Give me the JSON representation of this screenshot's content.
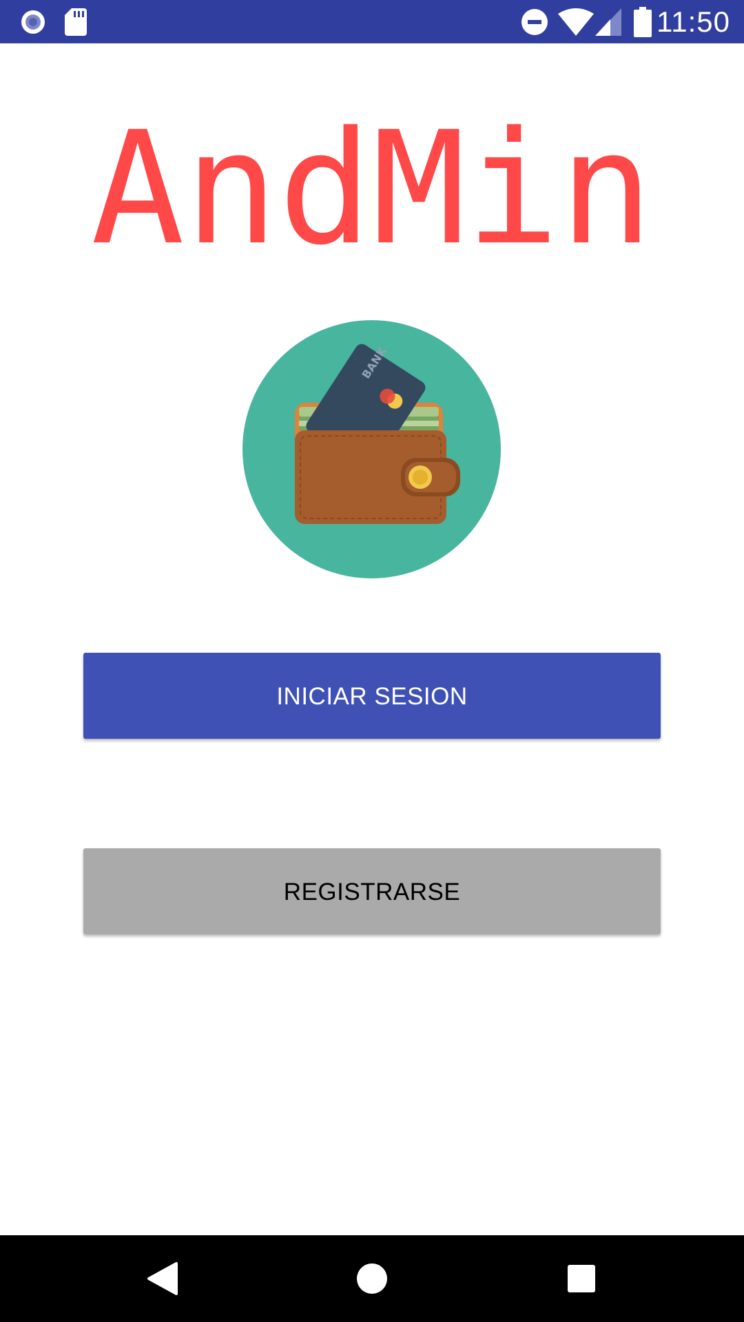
{
  "status_bar": {
    "time": "11:50",
    "icons": [
      "record-icon",
      "sd-card-icon",
      "do-not-disturb-icon",
      "wifi-icon",
      "cell-signal-icon",
      "battery-icon"
    ]
  },
  "app": {
    "title": "AndMin",
    "logo_text": "BANK"
  },
  "buttons": {
    "login_label": "INICIAR SESION",
    "register_label": "REGISTRARSE"
  },
  "nav_bar": {
    "icons": [
      "back-icon",
      "home-icon",
      "recents-icon"
    ]
  },
  "colors": {
    "status_bar": "#303F9F",
    "title": "#FF4949",
    "primary_button": "#3F51B5",
    "secondary_button": "#AAAAAA",
    "logo_circle": "#48B59E"
  }
}
